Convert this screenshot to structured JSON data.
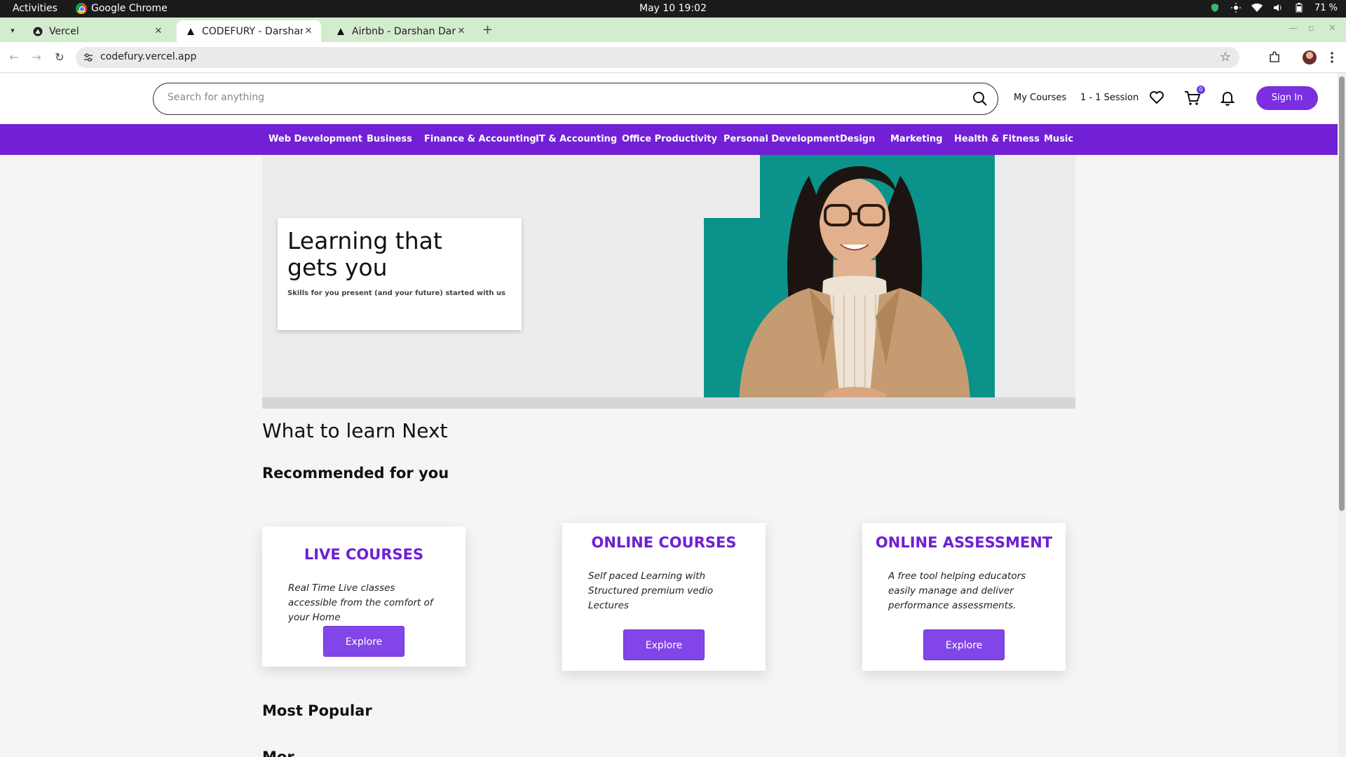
{
  "os": {
    "activities": "Activities",
    "app_name": "Google Chrome",
    "clock": "May 10  19:02",
    "battery": "71 %"
  },
  "browser": {
    "tabs": [
      {
        "title": "Vercel",
        "active": false
      },
      {
        "title": "CODEFURY - Darshan - S",
        "active": true
      },
      {
        "title": "Airbnb - Darshan Darshu",
        "active": false
      }
    ],
    "url": "codefury.vercel.app"
  },
  "header": {
    "search_placeholder": "Search for anything",
    "my_courses": "My Courses",
    "session": "1 - 1 Session",
    "cart_count": "0",
    "sign_in": "Sign In"
  },
  "categories": [
    "Web Development",
    "Business",
    "Finance & Accounting",
    "IT & Accounting",
    "Office Productivity",
    "Personal Development",
    "Design",
    "Marketing",
    "Health & Fitness",
    "Music"
  ],
  "hero": {
    "title": "Learning that gets you",
    "subtitle": "Skills for you present (and your future) started with us"
  },
  "sections": {
    "what_next": "What to learn Next",
    "recommended": "Recommended for you",
    "most_popular": "Most Popular",
    "cut_off": "Mor"
  },
  "cards": [
    {
      "title": "LIVE COURSES",
      "text": "Real Time Live classes accessible from the comfort of your Home",
      "button": "Explore"
    },
    {
      "title": "ONLINE COURSES",
      "text": "Self paced Learning with Structured premium vedio Lectures",
      "button": "Explore"
    },
    {
      "title": "ONLINE ASSESSMENT",
      "text": "A free tool helping educators easily manage and deliver performance assessments.",
      "button": "Explore"
    }
  ],
  "colors": {
    "brand_purple": "#7120d6",
    "button_purple": "#8246e8",
    "hero_teal": "#0b928a",
    "tabstrip_green": "#d3ebce"
  }
}
